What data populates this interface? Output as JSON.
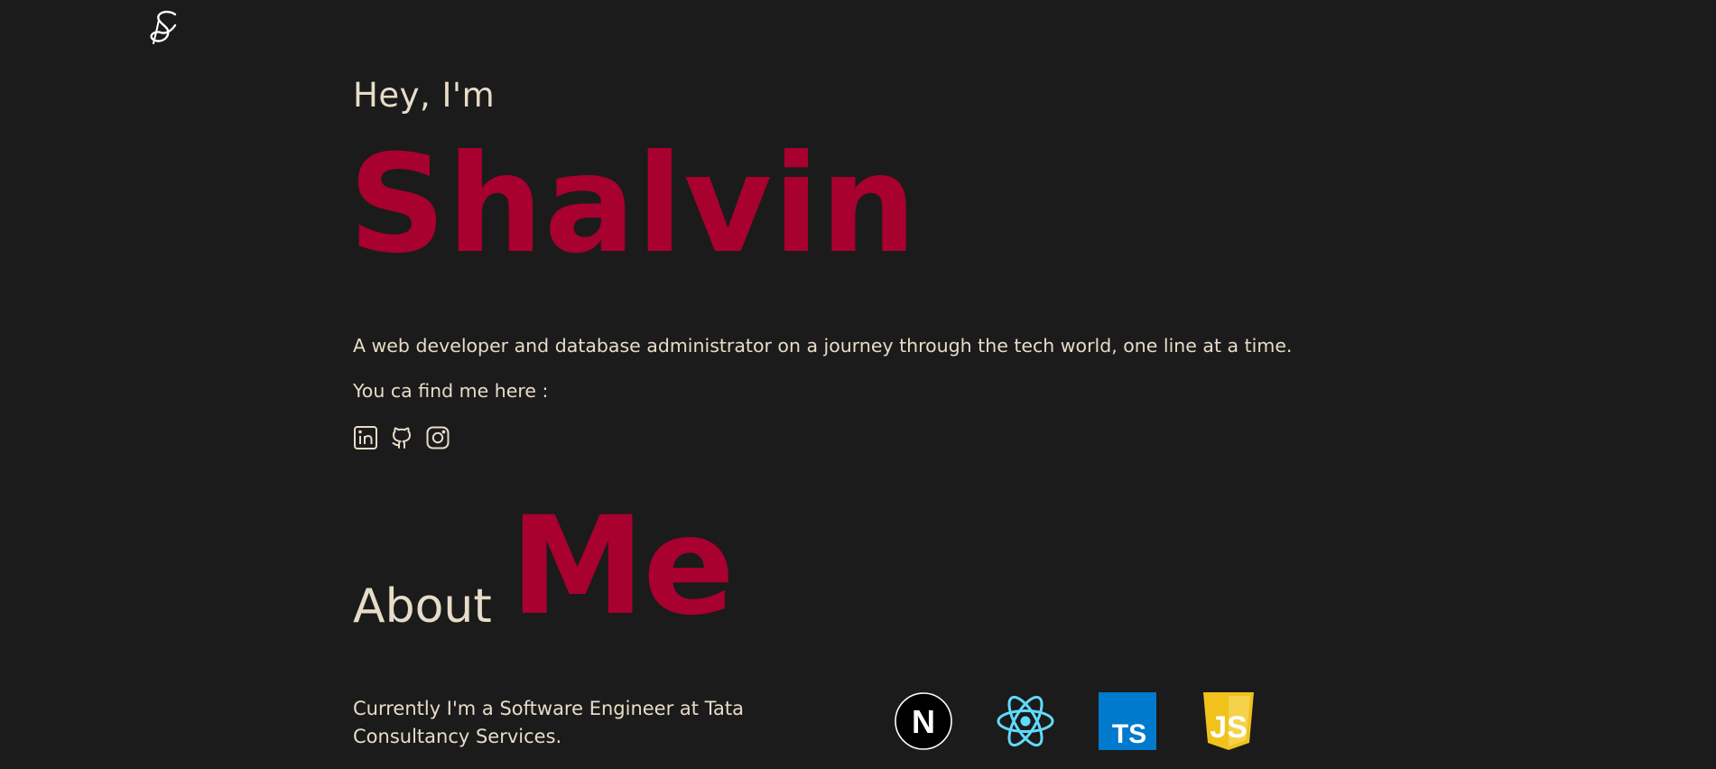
{
  "logo": {
    "icon": "signature-s-logo-icon"
  },
  "hero": {
    "greeting": "Hey, I'm",
    "name": "Shalvin",
    "tagline": "A web developer and database administrator on a journey through the tech world, one line at a time.",
    "find_me": "You ca find me here :"
  },
  "socials": [
    {
      "icon": "linkedin-icon"
    },
    {
      "icon": "github-icon"
    },
    {
      "icon": "instagram-icon"
    }
  ],
  "about": {
    "label": "About",
    "highlight": "Me",
    "current_role": "Currently I'm a Software Engineer at Tata Consultancy Services."
  },
  "tech_stack": [
    {
      "icon": "nextjs-icon",
      "label": "N"
    },
    {
      "icon": "react-icon"
    },
    {
      "icon": "typescript-icon",
      "label": "TS"
    },
    {
      "icon": "javascript-icon",
      "label": "JS"
    }
  ],
  "colors": {
    "background": "#1b1b1b",
    "text": "#e6dcc8",
    "accent": "#a8002f",
    "react": "#61dafb",
    "typescript": "#007acc",
    "javascript": "#f0c21b"
  }
}
